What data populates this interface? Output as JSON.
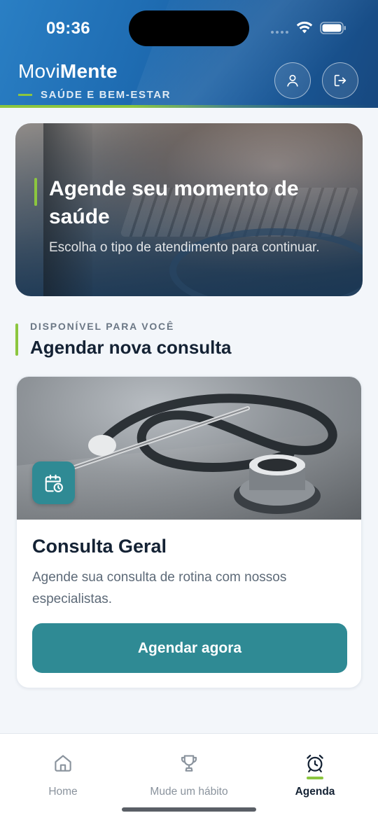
{
  "status_bar": {
    "time": "09:36"
  },
  "header": {
    "brand_light": "Movi",
    "brand_bold": "Mente",
    "tagline": "SAÚDE E BEM-ESTAR",
    "accent_color": "#8cc63f",
    "background_color": "#1f6db3",
    "buttons": [
      {
        "icon": "user-icon"
      },
      {
        "icon": "logout-icon"
      }
    ]
  },
  "hero": {
    "title": "Agende seu momento de saúde",
    "subtitle": "Escolha o tipo de atendimento para continuar."
  },
  "section": {
    "eyebrow": "DISPONÍVEL PARA VOCÊ",
    "title": "Agendar nova consulta"
  },
  "consult_card": {
    "icon": "calendar-clock-icon",
    "title": "Consulta Geral",
    "description": "Agende sua consulta de rotina com nossos especialistas.",
    "button_label": "Agendar agora",
    "button_color": "#2f8a94"
  },
  "bottom_nav": {
    "items": [
      {
        "label": "Home",
        "icon": "home-icon",
        "active": false
      },
      {
        "label": "Mude um hábito",
        "icon": "trophy-icon",
        "active": false
      },
      {
        "label": "Agenda",
        "icon": "alarm-clock-icon",
        "active": true
      }
    ]
  }
}
